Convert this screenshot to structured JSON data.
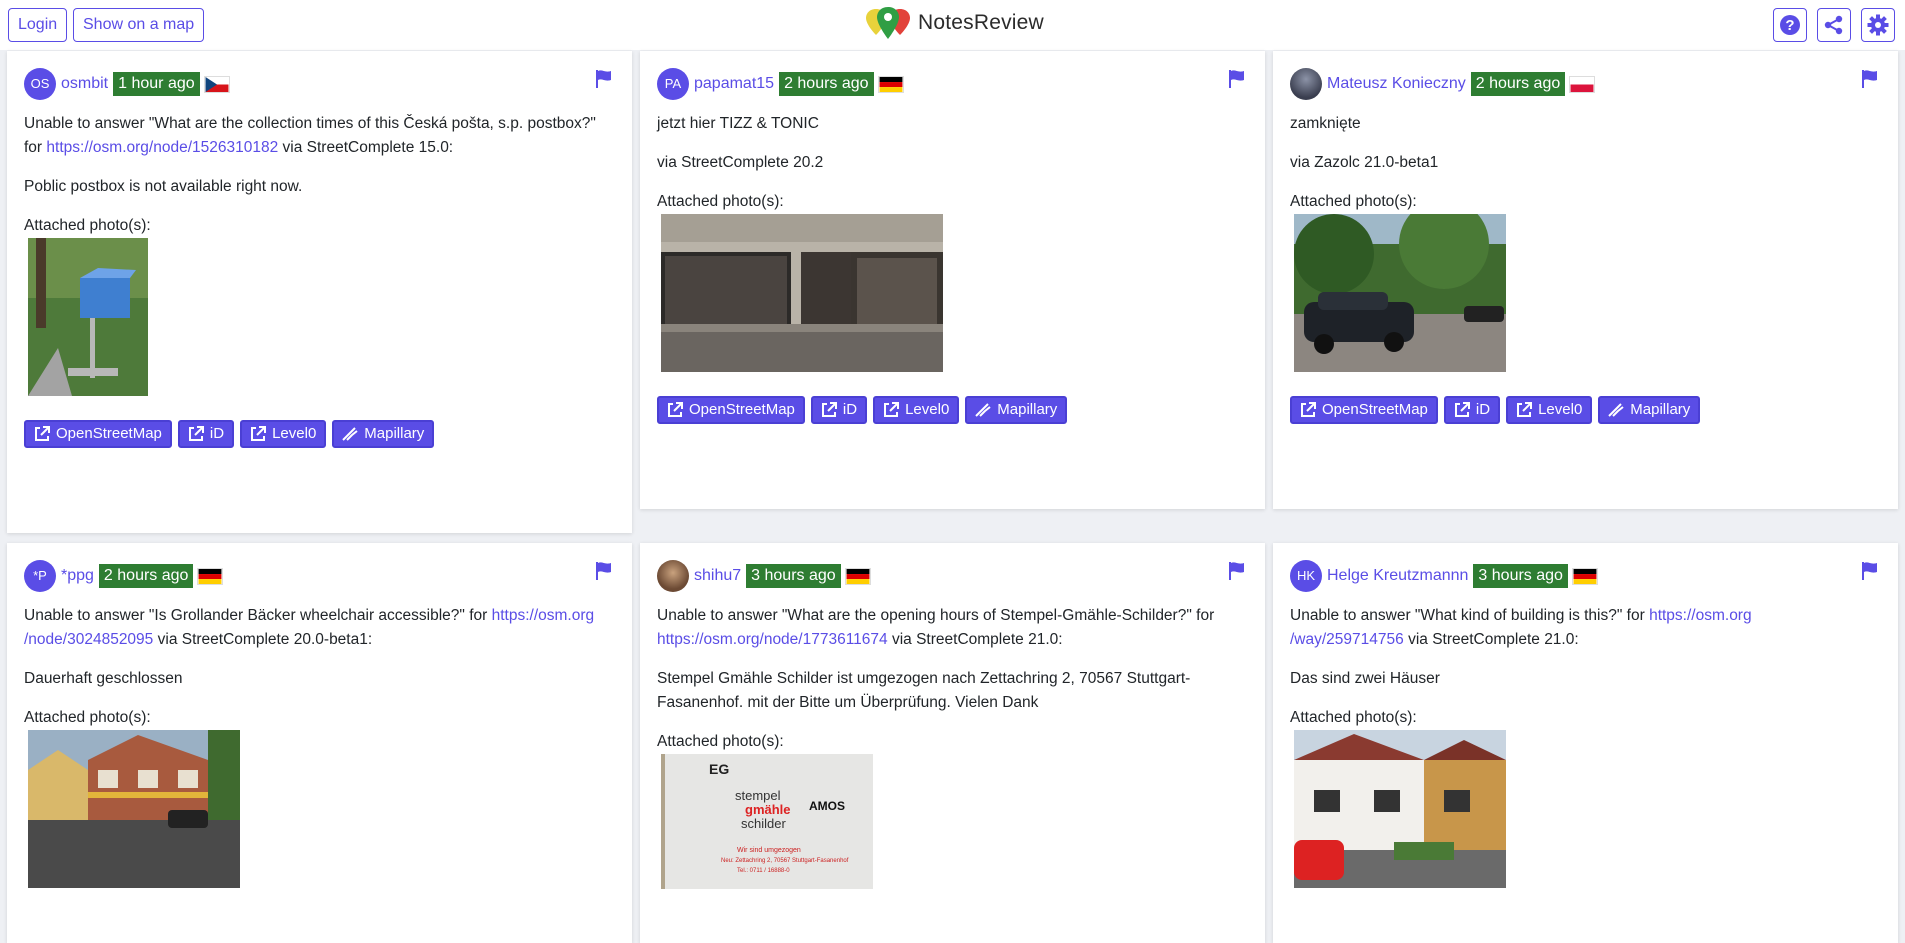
{
  "header": {
    "login_label": "Login",
    "map_label": "Show on a map",
    "brand": "NotesReview",
    "accent_color": "#5a4de6"
  },
  "actions": {
    "osm": "OpenStreetMap",
    "id": "iD",
    "level0": "Level0",
    "mapillary": "Mapillary"
  },
  "attached_label": "Attached photo(s):",
  "cards": [
    {
      "avatar": "OS",
      "user": "osmbit",
      "time": "1 hour ago",
      "country_flag": "cz",
      "line1_pre": "Unable to answer \"What are the collection times of this Česká pošta, s.p. postbox?\"",
      "line1_for": "for ",
      "link": "https://osm.org/node/1526310182",
      "line1_post": " via StreetComplete 15.0:",
      "para2": "Poblic postbox is not available right now.",
      "photo_desc": "blue postbox on stand in grass"
    },
    {
      "avatar": "PA",
      "user": "papamat15",
      "time": "2 hours ago",
      "country_flag": "de",
      "para1": "jetzt hier TIZZ & TONIC",
      "para2": "via StreetComplete 20.2",
      "photo_desc": "shop front window"
    },
    {
      "avatar": "",
      "user": "Mateusz Konieczny",
      "time": "2 hours ago",
      "country_flag": "pl",
      "para1": "zamknięte",
      "para2": "via Zazolc 21.0-beta1",
      "photo_desc": "car parked under trees"
    },
    {
      "avatar": "*P",
      "user": "*ppg",
      "time": "2 hours ago",
      "country_flag": "de",
      "line1_pre": "Unable to answer \"Is Grollander Bäcker wheelchair accessible?\" for ",
      "link_a": "https://osm.org",
      "link_b": "/node/3024852095",
      "line1_post": " via StreetComplete 20.0-beta1:",
      "para2": "Dauerhaft geschlossen",
      "photo_desc": "brick building corner shop"
    },
    {
      "avatar": "",
      "user": "shihu7",
      "time": "3 hours ago",
      "country_flag": "de",
      "line1_pre": "Unable to answer \"What are the opening hours of Stempel-Gmähle-Schilder?\" for",
      "link": "https://osm.org/node/1773611674",
      "line1_post": " via StreetComplete 21.0:",
      "para2_a": "Stempel Gmähle Schilder ist umgezogen nach Zettachring 2, 70567 Stuttgart-",
      "para2_b": "Fasanenhof. mit der Bitte um Überprüfung. Vielen Dank",
      "photo_desc": "moved notice sign"
    },
    {
      "avatar": "HK",
      "user": "Helge Kreutzmannn",
      "time": "3 hours ago",
      "country_flag": "de",
      "line1_pre": "Unable to answer \"What kind of building is this?\" for ",
      "link_a": "https://osm.org",
      "link_b": "/way/259714756",
      "line1_post": " via StreetComplete 21.0:",
      "para2": "Das sind zwei Häuser",
      "photo_desc": "two semi-detached houses"
    }
  ],
  "sign": {
    "eg": "EG",
    "brand1": "stempel",
    "brand2": "gmähle",
    "brand3": "schilder",
    "amos": "AMOS",
    "moved1": "Wir sind umgezogen",
    "moved2": "Neu: Zettachring 2, 70567 Stuttgart-Fasanenhof",
    "moved3": "Tel.: 0711 / 16888-0"
  }
}
